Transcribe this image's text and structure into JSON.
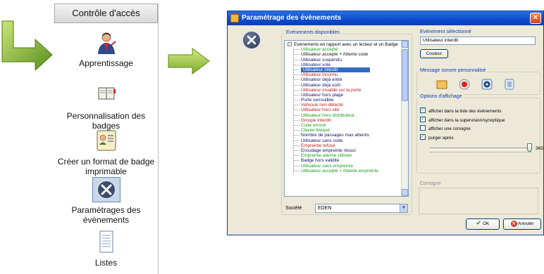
{
  "left_panel": {
    "header": "Contrôle d'accès",
    "items": [
      {
        "label": "Apprentissage",
        "icon": "user-learning-icon",
        "selected": false
      },
      {
        "label": "Personnalisation des badges",
        "icon": "badge-book-icon",
        "selected": false
      },
      {
        "label": "Créer un format de badge imprimable",
        "icon": "badge-card-icon",
        "selected": false
      },
      {
        "label": "Paramétrages des évènements",
        "icon": "tools-icon",
        "selected": true
      },
      {
        "label": "Listes",
        "icon": "list-document-icon",
        "selected": false
      }
    ]
  },
  "dialog": {
    "title": "Paramétrage des évènements",
    "available_events_label": "Evénements disponibles",
    "tree_root": "Evénements en rapport avec un lecteur et un Badge",
    "events": [
      {
        "label": "Utilisateur accepté",
        "color": "#1a9c1a"
      },
      {
        "label": "Utilisateur accepté + Attente code",
        "color": "#101010"
      },
      {
        "label": "Utilisateur suspendu",
        "color": "#101060"
      },
      {
        "label": "Utilisateur volé",
        "color": "#101060"
      },
      {
        "label": "Utilisateur interdit",
        "color": "#ffffff",
        "selected": true
      },
      {
        "label": "Utilisateur inconnu",
        "color": "#c01818"
      },
      {
        "label": "Utilisateur déjà entré",
        "color": "#101060"
      },
      {
        "label": "Utilisateur déjà sorti",
        "color": "#101060"
      },
      {
        "label": "Utilisateur invalide sur la porte",
        "color": "#c01818"
      },
      {
        "label": "Utilisateur hors plage",
        "color": "#101060"
      },
      {
        "label": "Porte verrouillée",
        "color": "#101060"
      },
      {
        "label": "Véhicule non détecté",
        "color": "#c01818"
      },
      {
        "label": "Utilisateur hors site",
        "color": "#c01818"
      },
      {
        "label": "Utilisateur hors distributeur",
        "color": "#1a9c1a"
      },
      {
        "label": "Groupe interdit",
        "color": "#c01818"
      },
      {
        "label": "Code erroné",
        "color": "#1a9c1a"
      },
      {
        "label": "Clavier bloqué",
        "color": "#1a9c1a"
      },
      {
        "label": "Nombre de passages max atteints",
        "color": "#101060"
      },
      {
        "label": "Utilisateur sans code",
        "color": "#101060"
      },
      {
        "label": "Empreinte refusé",
        "color": "#c01818"
      },
      {
        "label": "Encodage empreinte réussi",
        "color": "#101060"
      },
      {
        "label": "Empreinte alarme utilisée",
        "color": "#1a9c1a"
      },
      {
        "label": "Badge hors validité",
        "color": "#101060"
      },
      {
        "label": "Utilisateur sans empreinte",
        "color": "#1a9c1a"
      },
      {
        "label": "Utilisateur accepté + Attente empreinte",
        "color": "#1a9c1a"
      }
    ],
    "company_label": "Société",
    "company_value": "EDEN",
    "selected_event_label": "Evénement sélectionné",
    "selected_event_value": "Utilisateur interdit",
    "color_button": "Couleur",
    "sound_group_label": "Message sonore personnalisé",
    "sound_icons": [
      "folder-open-icon",
      "record-icon",
      "play-icon",
      "trash-icon"
    ],
    "display_options_label": "Options d'affichage",
    "options": [
      {
        "label": "afficher dans la liste des évènements",
        "checked": true
      },
      {
        "label": "afficher dans la supervision/synoptique",
        "checked": true
      },
      {
        "label": "afficher une consigne",
        "checked": false
      },
      {
        "label": "purger après",
        "checked": true
      }
    ],
    "purge_value": "365",
    "consigne_label": "Consigne",
    "ok_button": "OK",
    "cancel_button": "Annuler",
    "close_icon": "close-icon"
  },
  "colors": {
    "titlebar": "#0b4bd0",
    "selection": "#316ac5",
    "arrow_green": "#8cc63f"
  }
}
